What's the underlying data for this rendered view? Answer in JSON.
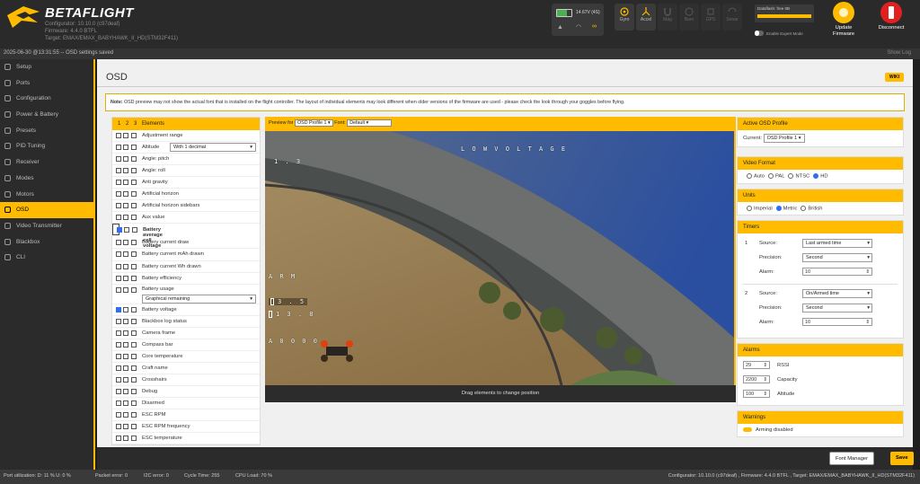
{
  "header": {
    "brand": "BETAFLIGHT",
    "configurator": "Configurator: 10.10.0 (c97deaf)",
    "firmware": "Firmware: 4.4.0 BTFL",
    "target": "Target: EMAX/EMAX_BABYHAWK_II_HD(STM32F411)",
    "battery": "14.67V (4S)",
    "sensors": [
      "Gyro",
      "Accel",
      "Mag",
      "Baro",
      "GPS",
      "Sonar"
    ],
    "dataflash": "Dataflash: free 0B",
    "expert": "Enable Expert Mode",
    "update": "Update Firmware",
    "disconnect": "Disconnect",
    "colors": {
      "accent": "#ffbb00",
      "disconnect": "#e02020"
    }
  },
  "message": {
    "text": "2025-06-30 @13:31:55 -- OSD settings saved",
    "showlog": "Show Log"
  },
  "nav": [
    "Setup",
    "Ports",
    "Configuration",
    "Power & Battery",
    "Presets",
    "PID Tuning",
    "Receiver",
    "Modes",
    "Motors",
    "OSD",
    "Video Transmitter",
    "Blackbox",
    "CLI"
  ],
  "osd": {
    "title": "OSD",
    "wiki": "WIKI",
    "note_b": "Note:",
    "note": " OSD preview may not show the actual font that is installed on the flight controller. The layout of individual elements may look different when older versions of the firmware are used - please check the look through your goggles before flying."
  },
  "elements": {
    "header": "Elements",
    "profiles": [
      "1",
      "2",
      "3"
    ],
    "items": [
      {
        "name": "Adjustment range"
      },
      {
        "name": "Altitude",
        "select": "With 1 decimal"
      },
      {
        "name": "Angle: pitch"
      },
      {
        "name": "Angle: roll"
      },
      {
        "name": "Anti gravity"
      },
      {
        "name": "Artificial horizon"
      },
      {
        "name": "Artificial horizon sidebars"
      },
      {
        "name": "Aux value"
      },
      {
        "name": "Battery average cell voltage",
        "checked": true,
        "selected": true
      },
      {
        "name": "Battery current draw"
      },
      {
        "name": "Battery current mAh drawn"
      },
      {
        "name": "Battery current Wh drawn"
      },
      {
        "name": "Battery efficiency"
      },
      {
        "name": "Battery usage",
        "select": "Graphical remaining"
      },
      {
        "name": "Battery voltage",
        "checked": true
      },
      {
        "name": "Blackbox log status"
      },
      {
        "name": "Camera frame"
      },
      {
        "name": "Compass bar"
      },
      {
        "name": "Core temperature"
      },
      {
        "name": "Craft name"
      },
      {
        "name": "Crosshairs"
      },
      {
        "name": "Debug"
      },
      {
        "name": "Disarmed"
      },
      {
        "name": "ESC RPM"
      },
      {
        "name": "ESC RPM frequency"
      },
      {
        "name": "ESC temperature"
      }
    ]
  },
  "preview": {
    "label": "Preview for",
    "profile": "OSD Profile 1",
    "font_label": "Font:",
    "font": "Default",
    "drag": "Drag elements to change position",
    "osd": {
      "warn": "L O W   V O L T A G E",
      "t1": "1 . 3",
      "arm": "A R M",
      "v1": "3 . 5",
      "v2": "1 3 . 8",
      "alt": "A 0 0 0 0"
    }
  },
  "active_profile": {
    "header": "Active OSD Profile",
    "label": "Current:",
    "value": "OSD Profile 1"
  },
  "video_format": {
    "header": "Video Format",
    "options": [
      "Auto",
      "PAL",
      "NTSC",
      "HD"
    ],
    "selected": "HD"
  },
  "units": {
    "header": "Units",
    "options": [
      "Imperial",
      "Metric",
      "British"
    ],
    "selected": "Metric"
  },
  "timers": {
    "header": "Timers",
    "source_label": "Source:",
    "precision_label": "Precision:",
    "alarm_label": "Alarm:",
    "items": [
      {
        "num": "1",
        "source": "Last armed time",
        "precision": "Second",
        "alarm": "10"
      },
      {
        "num": "2",
        "source": "On/Armed time",
        "precision": "Second",
        "alarm": "10"
      }
    ]
  },
  "alarms": {
    "header": "Alarms",
    "items": [
      {
        "value": "29",
        "label": "RSSI"
      },
      {
        "value": "2200",
        "label": "Capacity"
      },
      {
        "value": "100",
        "label": "Altitude"
      }
    ]
  },
  "warnings": {
    "header": "Warnings",
    "items": [
      {
        "label": "Arming disabled"
      }
    ]
  },
  "footer": {
    "font_manager": "Font Manager",
    "save": "Save"
  },
  "status": {
    "port": "Port utilization: D: 11 % U: 0 %",
    "packet": "Packet error: 0",
    "i2c": "I2C error: 0",
    "cycle": "Cycle Time: 255",
    "cpu": "CPU Load: 70 %",
    "right": "Configurator: 10.10.0 (c97deaf) , Firmware: 4.4.0 BTFL , Target: EMAX/EMAX_BABYHAWK_II_HD(STM32F411)"
  }
}
